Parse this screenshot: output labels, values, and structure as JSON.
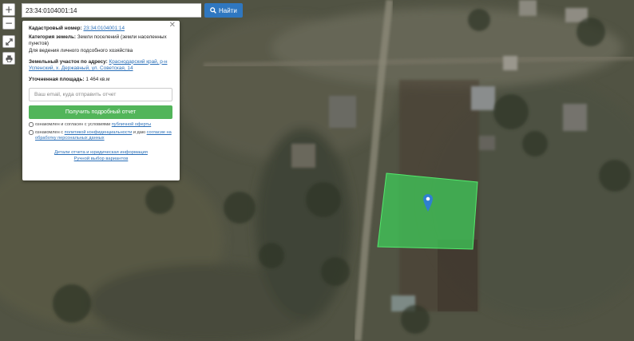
{
  "search": {
    "value": "23:34:0104001:14",
    "button_label": "Найти"
  },
  "controls": {
    "zoom_in": "+",
    "zoom_out": "−"
  },
  "info": {
    "cadastral_label": "Кадастровый номер:",
    "cadastral_value": "23:34:0104001:14",
    "category_label": "Категория земель:",
    "category_value": "Земли поселений (земли населенных пунктов)",
    "purpose_value": "Для ведения личного подсобного хозяйства",
    "address_label": "Земельный участок по адресу:",
    "address_value": "Краснодарский край, р-н Успенский, х. Державный, ул. Советская, 14",
    "area_label": "Уточненная площадь:",
    "area_value": "1 464 кв.м",
    "email_placeholder": "Ваш email, куда отправить отчет",
    "report_button": "Получить подробный отчет",
    "consent1_text": "ознакомлен и согласен с условиями",
    "consent1_link": "публичной оферты",
    "consent2_text": "ознакомлен с",
    "consent2_link1": "политикой конфиденциальности",
    "consent2_mid": "и даю",
    "consent2_link2": "согласие на обработку персональных данных",
    "details_link": "Детали отчета и юридическая информация",
    "manual_link": "Ручной выбор вариантов"
  },
  "colors": {
    "parcel_fill": "#3fd05a",
    "marker": "#2f7fd0",
    "search_button": "#2f77c0",
    "report_button": "#52b55a"
  }
}
